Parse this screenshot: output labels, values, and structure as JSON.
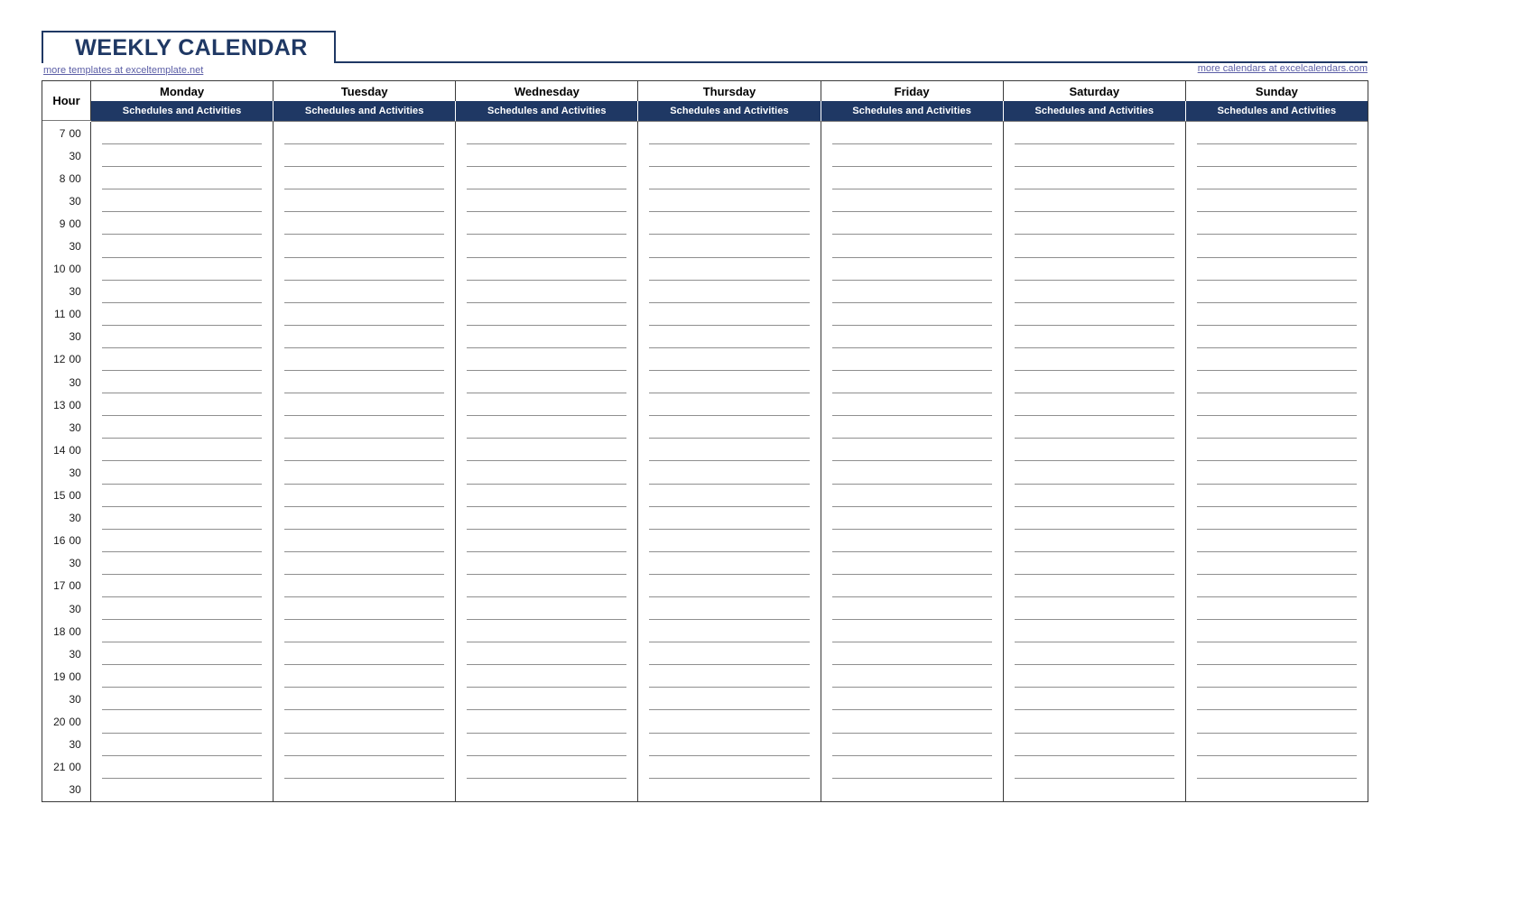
{
  "document": {
    "title": "WEEKLY CALENDAR",
    "accent_color": "#1f3864",
    "link_color": "#5b5ea6",
    "grid_line_color": "#8f8f8f",
    "border_color": "#3a3a3a"
  },
  "links": {
    "left": "more templates at exceltemplate.net",
    "right": "more calendars at excelcalendars.com"
  },
  "table": {
    "hour_header": "Hour",
    "days": [
      "Monday",
      "Tuesday",
      "Wednesday",
      "Thursday",
      "Friday",
      "Saturday",
      "Sunday"
    ],
    "subheader_label": "Schedules and Activities",
    "subheaders": [
      "Schedules and Activities",
      "Schedules and Activities",
      "Schedules and Activities",
      "Schedules and Activities",
      "Schedules and Activities",
      "Schedules and Activities",
      "Schedules and Activities"
    ],
    "time_format": "24-hour",
    "time_rows": [
      {
        "hour": "7",
        "minute": "00"
      },
      {
        "hour": "",
        "minute": "30"
      },
      {
        "hour": "8",
        "minute": "00"
      },
      {
        "hour": "",
        "minute": "30"
      },
      {
        "hour": "9",
        "minute": "00"
      },
      {
        "hour": "",
        "minute": "30"
      },
      {
        "hour": "10",
        "minute": "00"
      },
      {
        "hour": "",
        "minute": "30"
      },
      {
        "hour": "11",
        "minute": "00"
      },
      {
        "hour": "",
        "minute": "30"
      },
      {
        "hour": "12",
        "minute": "00"
      },
      {
        "hour": "",
        "minute": "30"
      },
      {
        "hour": "13",
        "minute": "00"
      },
      {
        "hour": "",
        "minute": "30"
      },
      {
        "hour": "14",
        "minute": "00"
      },
      {
        "hour": "",
        "minute": "30"
      },
      {
        "hour": "15",
        "minute": "00"
      },
      {
        "hour": "",
        "minute": "30"
      },
      {
        "hour": "16",
        "minute": "00"
      },
      {
        "hour": "",
        "minute": "30"
      },
      {
        "hour": "17",
        "minute": "00"
      },
      {
        "hour": "",
        "minute": "30"
      },
      {
        "hour": "18",
        "minute": "00"
      },
      {
        "hour": "",
        "minute": "30"
      },
      {
        "hour": "19",
        "minute": "00"
      },
      {
        "hour": "",
        "minute": "30"
      },
      {
        "hour": "20",
        "minute": "00"
      },
      {
        "hour": "",
        "minute": "30"
      },
      {
        "hour": "21",
        "minute": "00"
      },
      {
        "hour": "",
        "minute": "30"
      }
    ],
    "entries": []
  }
}
